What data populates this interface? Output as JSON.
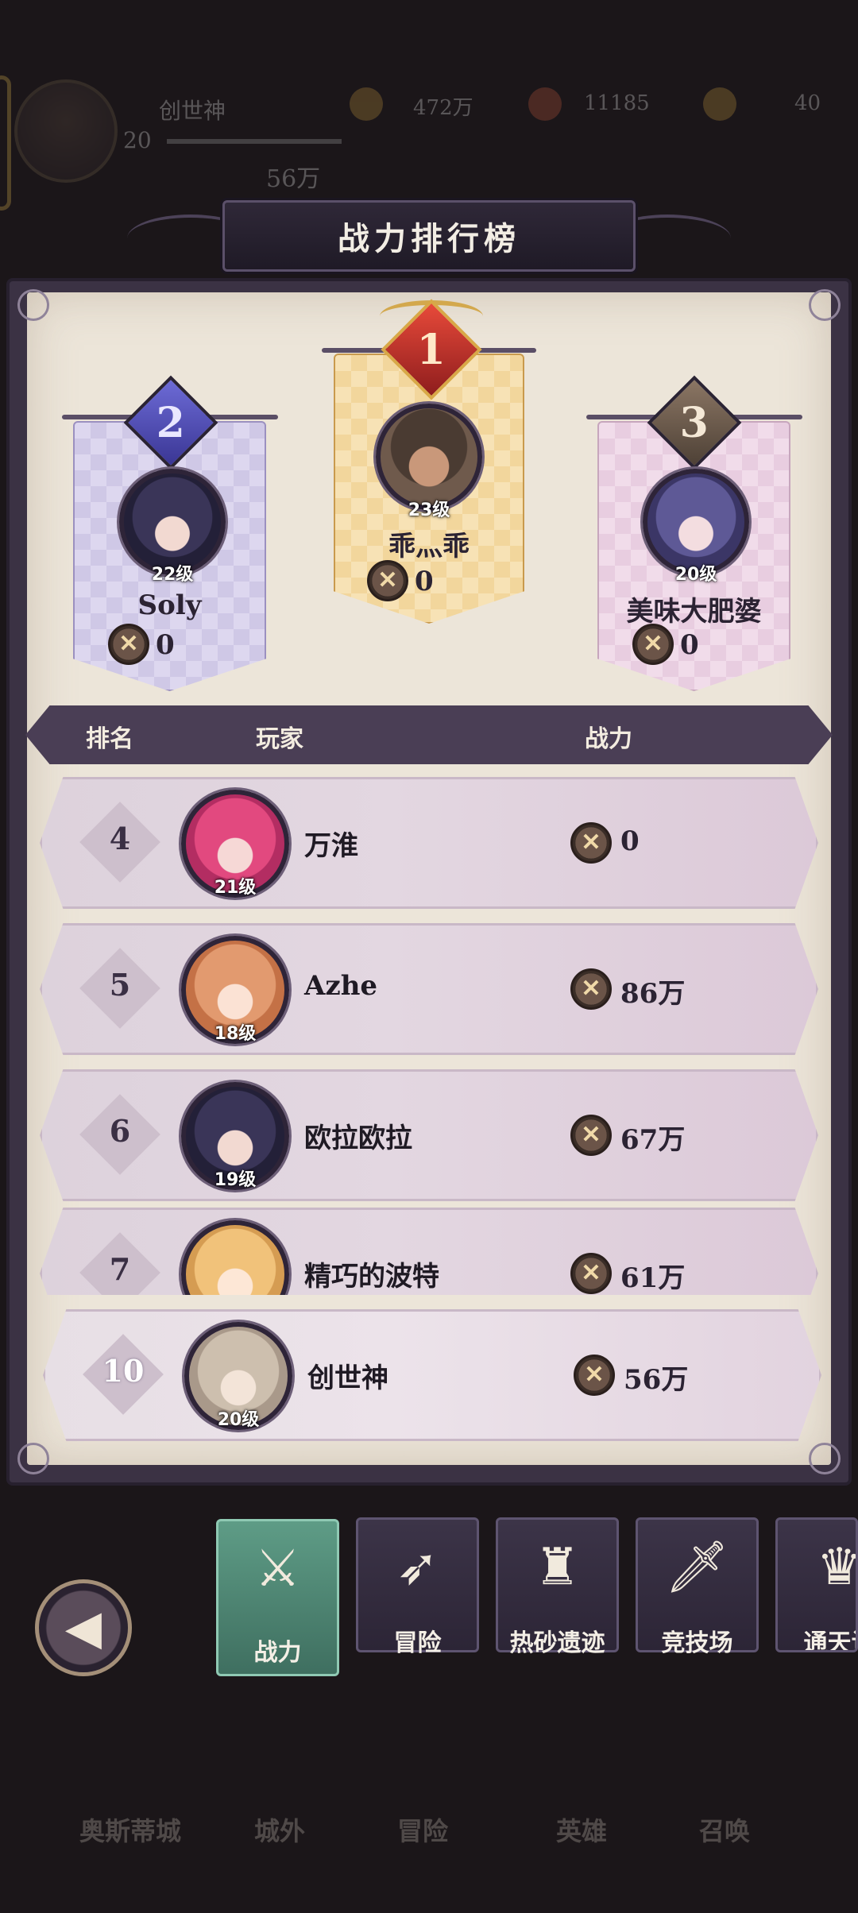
{
  "background_hud": {
    "player_name": "创世神",
    "player_level": "20",
    "power": "56万",
    "resources": [
      "472万",
      "11185",
      "40"
    ]
  },
  "title": "战力排行榜",
  "podium": [
    {
      "rank": "1",
      "name": "乖灬乖",
      "level": "23级",
      "power": "0"
    },
    {
      "rank": "2",
      "name": "Soly",
      "level": "22级",
      "power": "0"
    },
    {
      "rank": "3",
      "name": "美味大肥婆",
      "level": "20级",
      "power": "0"
    }
  ],
  "table_header": {
    "rank": "排名",
    "player": "玩家",
    "power": "战力"
  },
  "rows": [
    {
      "rank": "4",
      "name": "万淮",
      "level": "21级",
      "power": "0"
    },
    {
      "rank": "5",
      "name": "Azhe",
      "level": "18级",
      "power": "86万"
    },
    {
      "rank": "6",
      "name": "欧拉欧拉",
      "level": "19级",
      "power": "67万"
    },
    {
      "rank": "7",
      "name": "精巧的波特",
      "level": "",
      "power": "61万"
    }
  ],
  "self_row": {
    "rank": "10",
    "name": "创世神",
    "level": "20级",
    "power": "56万"
  },
  "tabs": [
    {
      "label": "战力",
      "icon": "crossed-swords-icon",
      "glyph": "⚔",
      "active": true
    },
    {
      "label": "冒险",
      "icon": "arrows-icon",
      "glyph": "➶",
      "active": false
    },
    {
      "label": "热砂遗迹",
      "icon": "tower-icon",
      "glyph": "♜",
      "active": false
    },
    {
      "label": "竞技场",
      "icon": "sword-trophy-icon",
      "glyph": "🗡",
      "active": false
    },
    {
      "label": "通天试",
      "icon": "crown-peaks-icon",
      "glyph": "♛",
      "active": false
    }
  ],
  "back_button": {
    "icon": "back-arrow-icon",
    "glyph": "◀"
  },
  "bottom_nav": [
    "奥斯蒂城",
    "城外",
    "冒险",
    "英雄",
    "召唤"
  ],
  "power_icon_glyph": "✕",
  "colors": {
    "active_tab": "#5e9c86",
    "gold": "#d3a84d",
    "panel_bg": "#ece5d9",
    "frame": "#3b3244"
  }
}
